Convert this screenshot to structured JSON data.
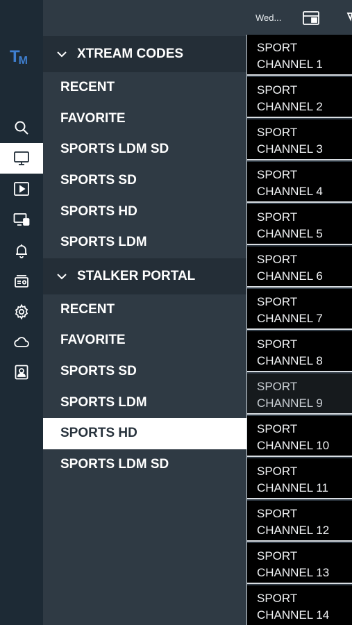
{
  "topbar": {
    "date_text": "Wed..."
  },
  "logo": {
    "text_t": "T",
    "text_m": "M"
  },
  "rail": {
    "items": [
      {
        "name": "search-icon"
      },
      {
        "name": "tv-icon"
      },
      {
        "name": "play-icon"
      },
      {
        "name": "devices-icon"
      },
      {
        "name": "bell-icon"
      },
      {
        "name": "radio-icon"
      },
      {
        "name": "gear-icon"
      },
      {
        "name": "cloud-icon"
      },
      {
        "name": "contact-icon"
      }
    ],
    "active_index": 1
  },
  "groups": [
    {
      "title": "XTREAM CODES",
      "items": [
        "RECENT",
        "FAVORITE",
        "SPORTS LDM SD",
        "SPORTS SD",
        "SPORTS HD",
        "SPORTS LDM"
      ]
    },
    {
      "title": "STALKER PORTAL",
      "items": [
        "RECENT",
        "FAVORITE",
        "SPORTS SD",
        "SPORTS LDM",
        "SPORTS HD",
        "SPORTS LDM SD"
      ]
    }
  ],
  "selected_category": "STALKER PORTAL / SPORTS HD",
  "channels": [
    {
      "line1": "SPORT",
      "line2": "CHANNEL 1"
    },
    {
      "line1": "SPORT",
      "line2": "CHANNEL 2"
    },
    {
      "line1": "SPORT",
      "line2": "CHANNEL 3"
    },
    {
      "line1": "SPORT",
      "line2": "CHANNEL 4"
    },
    {
      "line1": "SPORT",
      "line2": "CHANNEL 5"
    },
    {
      "line1": "SPORT",
      "line2": "CHANNEL 6"
    },
    {
      "line1": "SPORT",
      "line2": "CHANNEL 7"
    },
    {
      "line1": "SPORT",
      "line2": "CHANNEL 8"
    },
    {
      "line1": "SPORT",
      "line2": "CHANNEL 9"
    },
    {
      "line1": "SPORT",
      "line2": "CHANNEL 10"
    },
    {
      "line1": "SPORT",
      "line2": "CHANNEL 11"
    },
    {
      "line1": "SPORT",
      "line2": "CHANNEL 12"
    },
    {
      "line1": "SPORT",
      "line2": "CHANNEL 13"
    },
    {
      "line1": "SPORT",
      "line2": "CHANNEL 14"
    }
  ],
  "highlighted_channel": "CHANNEL 9",
  "colors": {
    "rail_bg": "#1d2a35",
    "panel_bg": "#2f3a44",
    "header_bg": "#242e37",
    "accent_logo": "#3f7fd0",
    "selected_bg": "#ffffff"
  }
}
